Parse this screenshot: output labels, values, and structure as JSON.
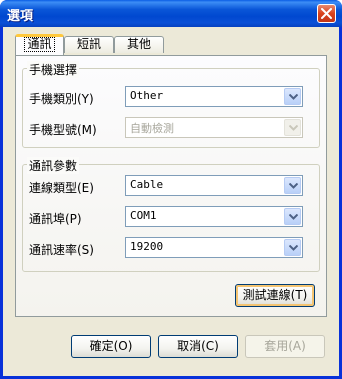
{
  "window": {
    "title": "選項"
  },
  "tabs": [
    {
      "label": "通訊",
      "active": true
    },
    {
      "label": "短訊",
      "active": false
    },
    {
      "label": "其他",
      "active": false
    }
  ],
  "phone_group": {
    "title": "手機選擇",
    "type_label": "手機類別(Y)",
    "type_value": "Other",
    "model_label": "手機型號(M)",
    "model_value": "自動檢測"
  },
  "comm_group": {
    "title": "通訊參數",
    "conn_label": "連線類型(E)",
    "conn_value": "Cable",
    "port_label": "通訊埠(P)",
    "port_value": "COM1",
    "speed_label": "通訊速率(S)",
    "speed_value": "19200"
  },
  "buttons": {
    "test": "測試連線(T)",
    "ok": "確定(O)",
    "cancel": "取消(C)",
    "apply": "套用(A)"
  },
  "colors": {
    "title_bar": "#0a56d8",
    "dialog_bg": "#ece9d8",
    "focus_ring": "#f4c471"
  },
  "icons": {
    "close": "close-icon",
    "dropdown": "chevron-down-icon"
  }
}
